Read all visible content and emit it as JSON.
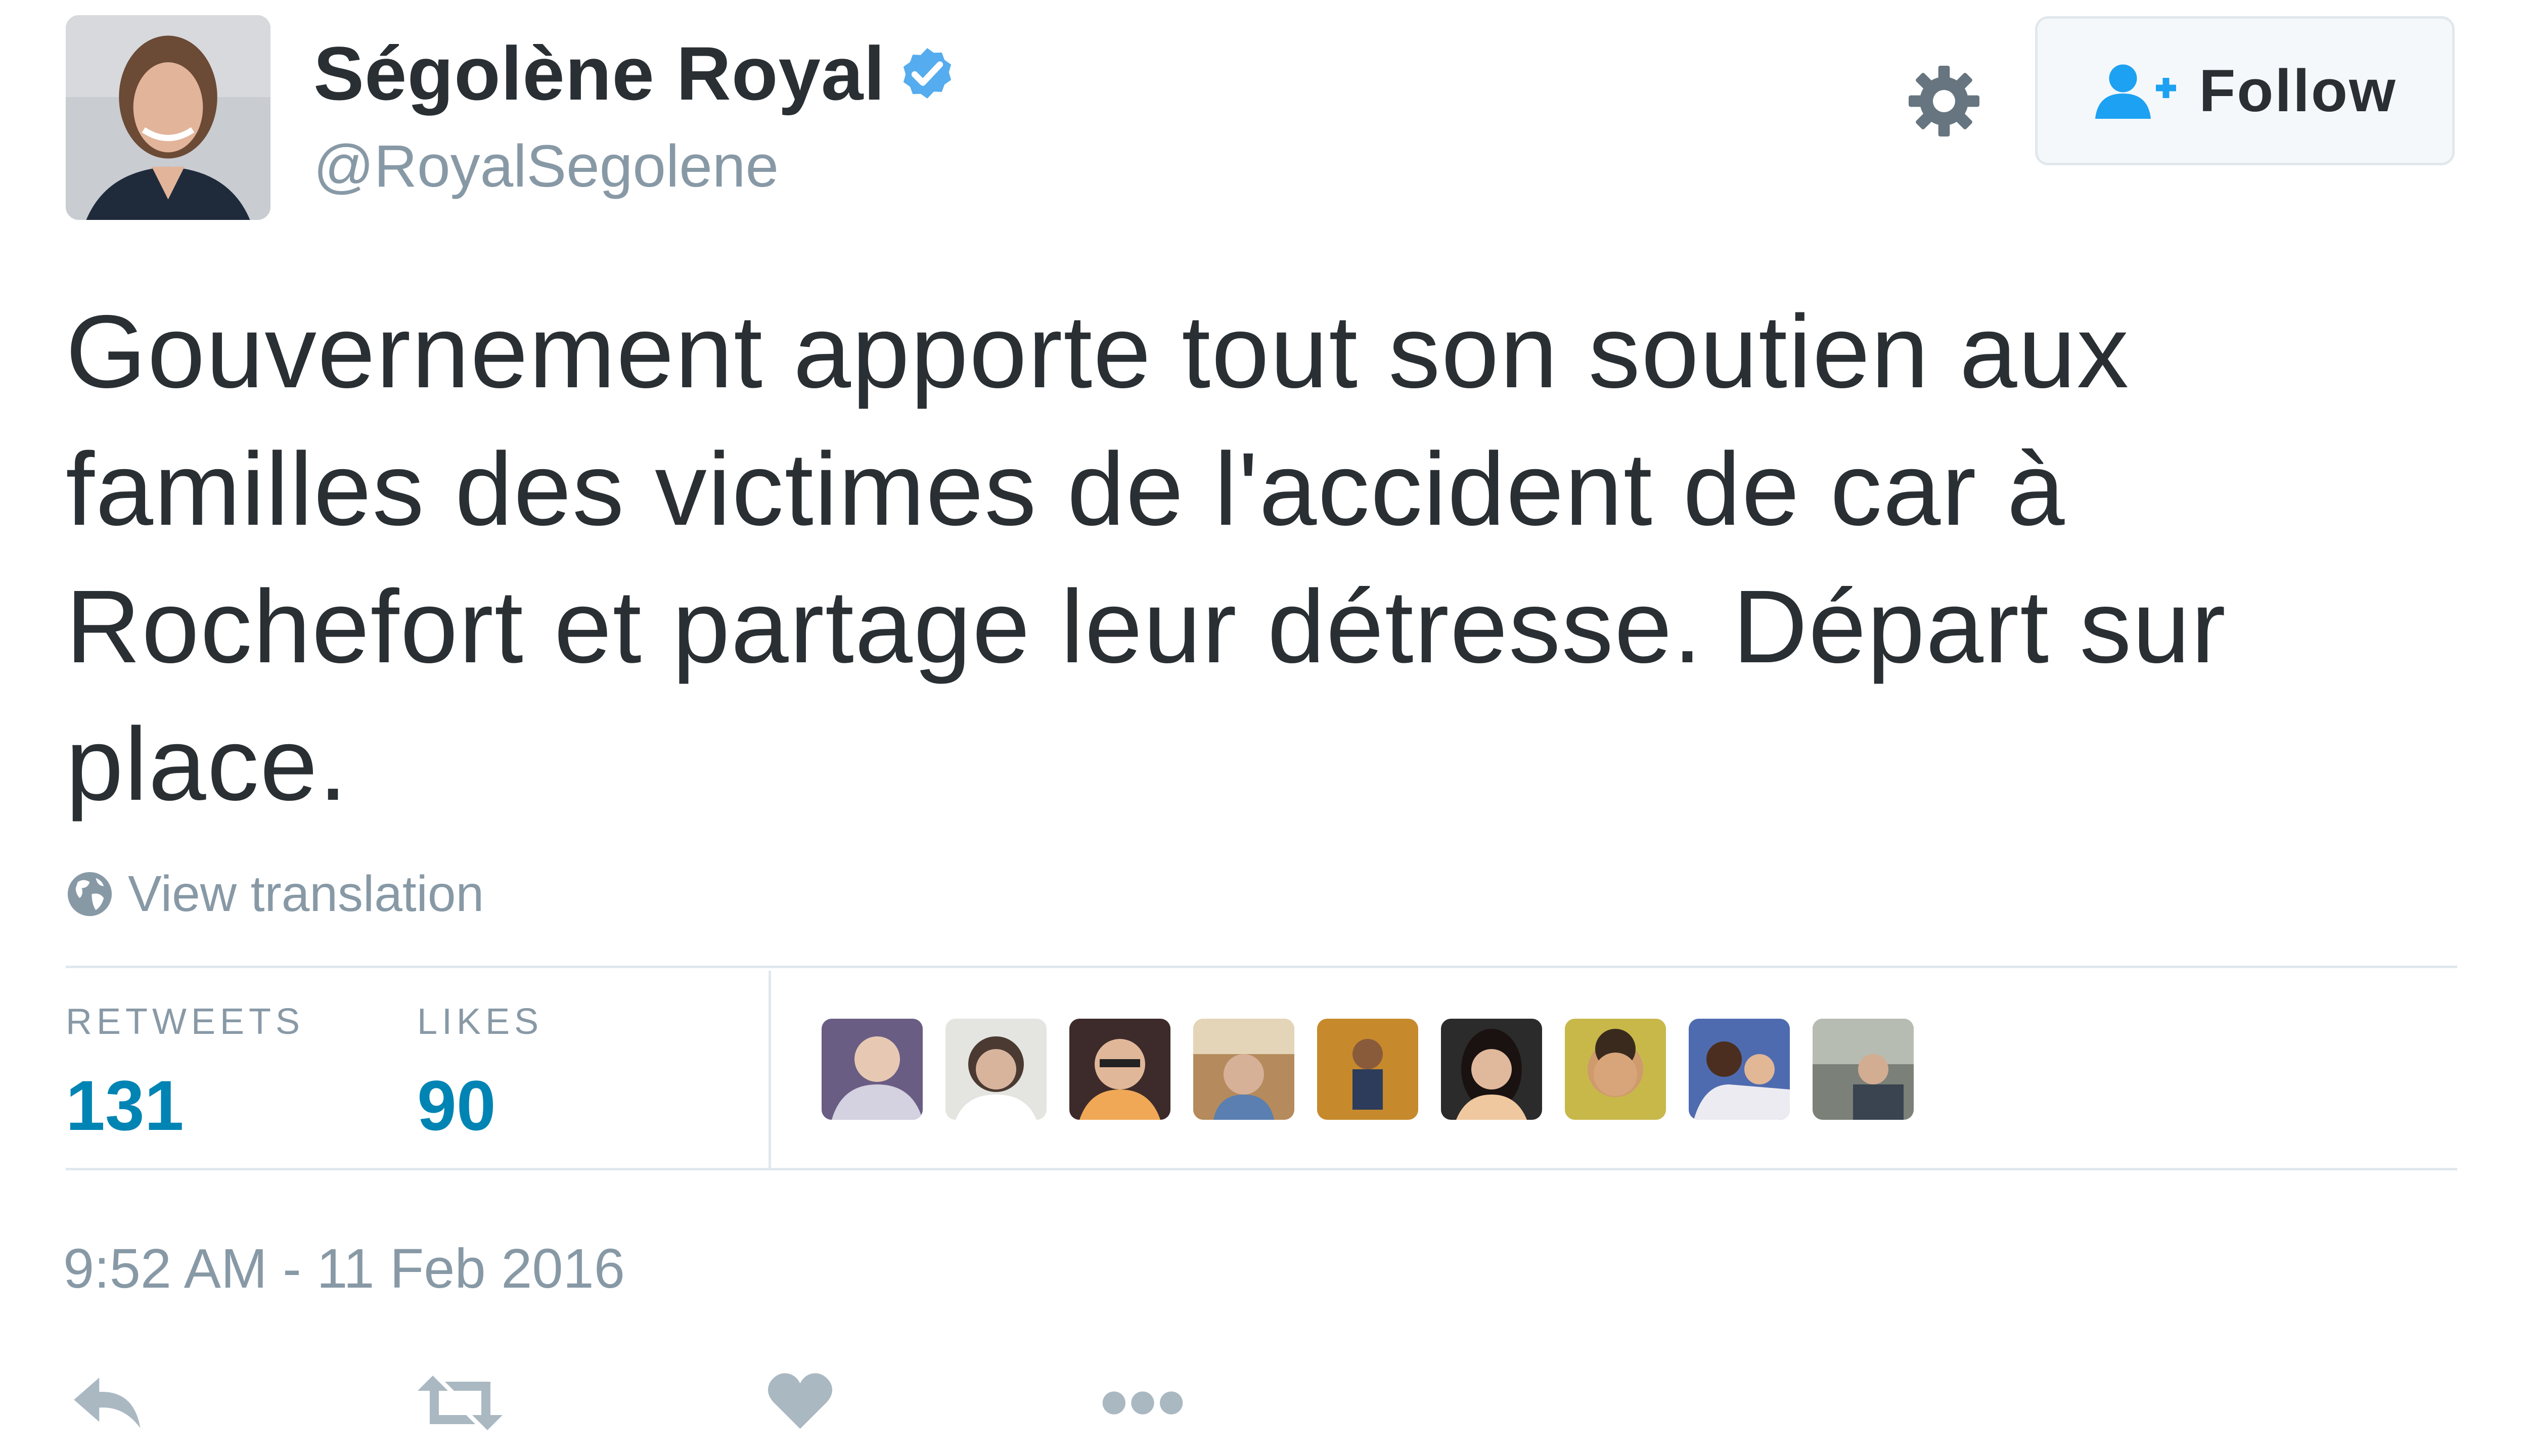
{
  "user": {
    "name": "Ségolène Royal",
    "handle": "@RoyalSegolene",
    "verified": true
  },
  "follow_button": {
    "label": "Follow"
  },
  "tweet": {
    "text": "Gouvernement apporte tout son soutien aux familles des victimes de l'accident de car à Rochefort et partage leur détresse. Départ sur place.",
    "view_translation": "View translation",
    "timestamp": "9:52 AM - 11 Feb 2016"
  },
  "stats": {
    "retweets_label": "RETWEETS",
    "retweets_value": "131",
    "likes_label": "LIKES",
    "likes_value": "90"
  },
  "likers_count": 9,
  "icons": {
    "gear": "gear-icon",
    "verified": "verified-badge-icon",
    "follow": "add-user-icon",
    "globe": "globe-icon",
    "reply": "reply-icon",
    "retweet": "retweet-icon",
    "like": "heart-icon",
    "more": "more-icon"
  },
  "colors": {
    "link_blue": "#0084b4",
    "verified_blue": "#55acee",
    "muted_text": "#8899a6",
    "body_text": "#292f33",
    "border": "#e1e8ed",
    "action_icon": "#aab8c2"
  }
}
